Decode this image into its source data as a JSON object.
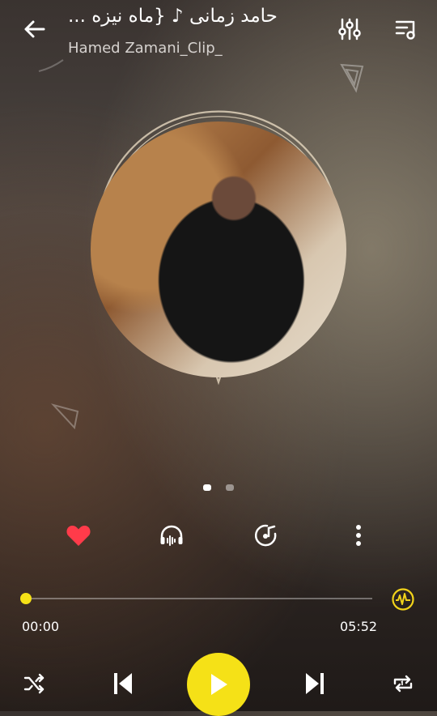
{
  "header": {
    "title": "حامد زمانی ♪ {ماه نیزه ...",
    "artist": "Hamed Zamani_Clip_"
  },
  "icons": {
    "back": "arrow-left-icon",
    "equalizer": "equalizer-icon",
    "queue": "playlist-icon",
    "favorite": "heart-icon",
    "headphones": "headphones-icon",
    "ringtone": "disc-note-icon",
    "more": "more-vertical-icon",
    "visualizer": "waveform-icon",
    "shuffle": "shuffle-icon",
    "previous": "skip-previous-icon",
    "play": "play-icon",
    "next": "skip-next-icon",
    "repeat": "repeat-one-icon"
  },
  "pager": {
    "count": 2,
    "active": 0
  },
  "playback": {
    "elapsed": "00:00",
    "duration": "05:52",
    "progress_fraction": 0.0,
    "favorited": true
  },
  "colors": {
    "accent": "#f5e117",
    "heart": "#ff3b4a"
  }
}
